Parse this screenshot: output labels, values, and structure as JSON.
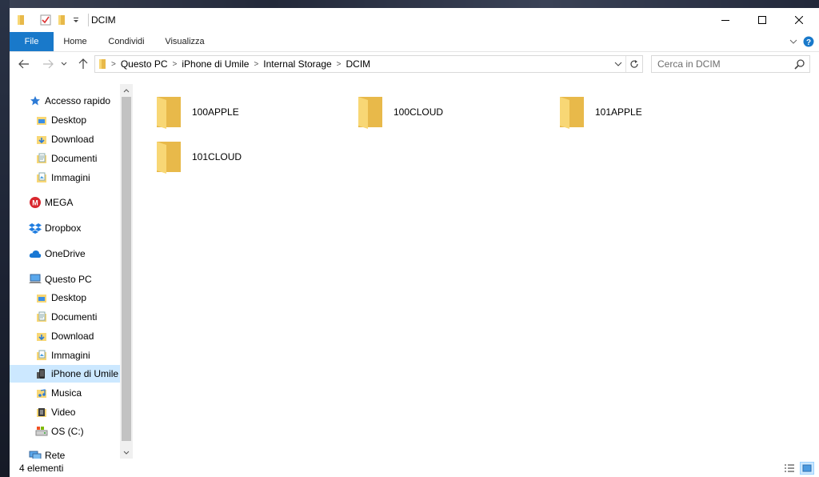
{
  "window": {
    "title": "DCIM",
    "controls": {
      "minimize": "—",
      "maximize": "☐",
      "close": "✕"
    }
  },
  "ribbon": {
    "tabs": [
      {
        "label": "File"
      },
      {
        "label": "Home"
      },
      {
        "label": "Condividi"
      },
      {
        "label": "Visualizza"
      }
    ]
  },
  "address": {
    "path": [
      "Questo PC",
      "iPhone di Umile",
      "Internal Storage",
      "DCIM"
    ]
  },
  "search": {
    "placeholder": "Cerca in DCIM"
  },
  "sidebar": {
    "quick_access": {
      "label": "Accesso rapido",
      "items": [
        {
          "label": "Desktop",
          "icon": "desktop-folder-icon",
          "pinned": true
        },
        {
          "label": "Download",
          "icon": "download-folder-icon",
          "pinned": true
        },
        {
          "label": "Documenti",
          "icon": "documents-folder-icon",
          "pinned": true
        },
        {
          "label": "Immagini",
          "icon": "pictures-folder-icon",
          "pinned": true
        }
      ]
    },
    "mega": {
      "label": "MEGA"
    },
    "dropbox": {
      "label": "Dropbox"
    },
    "onedrive": {
      "label": "OneDrive"
    },
    "this_pc": {
      "label": "Questo PC",
      "items": [
        {
          "label": "Desktop",
          "icon": "desktop-folder-icon"
        },
        {
          "label": "Documenti",
          "icon": "documents-folder-icon"
        },
        {
          "label": "Download",
          "icon": "download-folder-icon"
        },
        {
          "label": "Immagini",
          "icon": "pictures-folder-icon"
        },
        {
          "label": "iPhone di Umile",
          "icon": "iphone-icon",
          "selected": true
        },
        {
          "label": "Musica",
          "icon": "music-folder-icon"
        },
        {
          "label": "Video",
          "icon": "video-folder-icon"
        },
        {
          "label": "OS (C:)",
          "icon": "drive-icon"
        }
      ]
    },
    "network": {
      "label": "Rete"
    }
  },
  "content": {
    "folders": [
      {
        "name": "100APPLE"
      },
      {
        "name": "100CLOUD"
      },
      {
        "name": "101APPLE"
      },
      {
        "name": "101CLOUD"
      }
    ]
  },
  "status": {
    "count": "4 elementi"
  },
  "colors": {
    "accent": "#1979ca",
    "selected": "#cce8ff",
    "folder": "#f8d775"
  }
}
